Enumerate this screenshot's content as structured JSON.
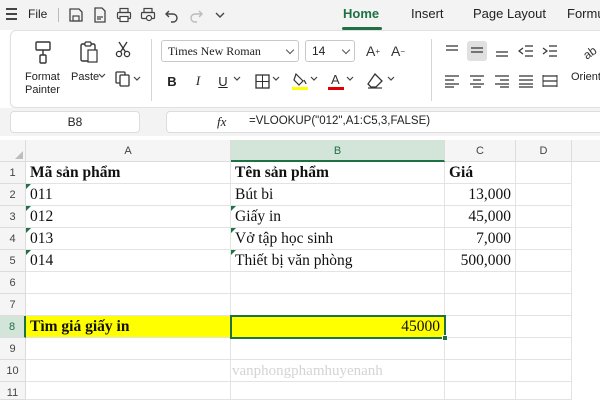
{
  "topbar": {
    "file_label": "File",
    "tabs": [
      "Home",
      "Insert",
      "Page Layout",
      "Formu"
    ],
    "active_tab": "Home"
  },
  "ribbon": {
    "format_painter": "Format\nPainter",
    "paste": "Paste",
    "font_name": "Times New Roman",
    "font_size": "14",
    "orient_label": "Orient"
  },
  "formula_bar": {
    "name_box": "B8",
    "fx": "fx",
    "formula": "=VLOOKUP(\"012\",A1:C5,3,FALSE)"
  },
  "sheet": {
    "columns": [
      "A",
      "B",
      "C",
      "D"
    ],
    "rows": [
      "1",
      "2",
      "3",
      "4",
      "5",
      "6",
      "7",
      "8",
      "9",
      "10",
      "11"
    ],
    "cells": {
      "A1": "Mã sản phẩm",
      "B1": "Tên sản phẩm",
      "C1": "Giá",
      "A2": "011",
      "B2": "Bút bi",
      "C2": "13,000",
      "A3": "012",
      "B3": "Giấy in",
      "C3": "45,000",
      "A4": "013",
      "B4": "Vở tập học sinh",
      "C4": "7,000",
      "A5": "014",
      "B5": "Thiết bị văn phòng",
      "C5": "500,000",
      "A8": "Tìm giá giấy in",
      "B8": "45000"
    },
    "selected_cell": "B8",
    "highlight_color": "#ffff00",
    "accent_color": "#1e7145"
  },
  "watermark": "vanphongphamhuyenanh"
}
